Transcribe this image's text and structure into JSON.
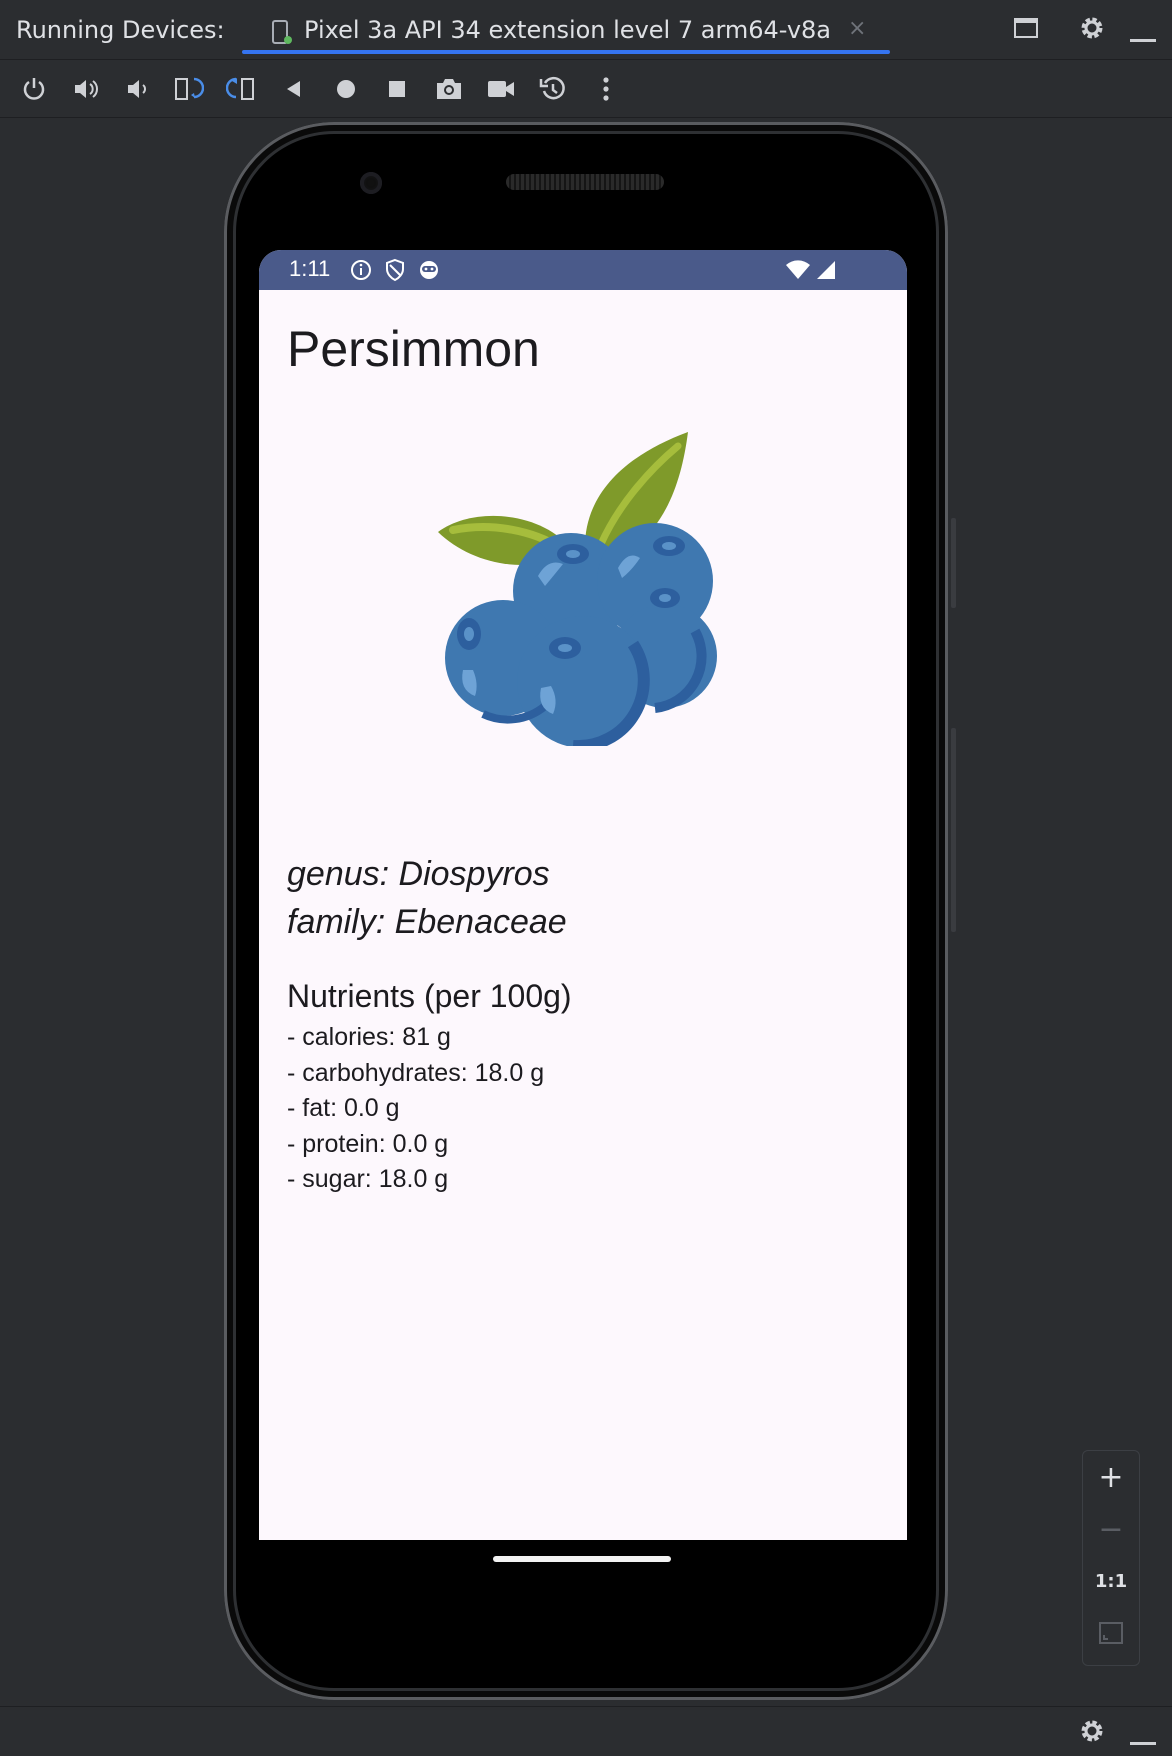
{
  "window": {
    "panel_label": "Running Devices:",
    "device_tab": "Pixel 3a API 34 extension level 7 arm64-v8a",
    "close_glyph": "×"
  },
  "toolbar": {
    "icons": [
      "power-icon",
      "volume-up-icon",
      "volume-down-icon",
      "rotate-left-icon",
      "rotate-right-icon",
      "back-icon",
      "home-icon",
      "overview-icon",
      "screenshot-icon",
      "screen-record-icon",
      "snapshot-icon",
      "more-icon"
    ]
  },
  "status_bar": {
    "time": "1:11"
  },
  "app": {
    "title": "Persimmon",
    "genus": "genus: Diospyros",
    "family": "family: Ebenaceae",
    "nutrients_heading": "Nutrients (per 100g)",
    "nutrients": [
      "- calories: 81 g",
      "- carbohydrates: 18.0 g",
      "- fat: 0.0 g",
      "- protein: 0.0 g",
      "- sugar: 18.0 g"
    ]
  },
  "zoom": {
    "plus": "+",
    "minus": "−",
    "one_to_one": "1:1"
  },
  "colors": {
    "accent": "#3574f0",
    "status_bar": "#4a5a8a",
    "screen_bg": "#fdf8fd",
    "berry": "#3f78b0",
    "leaf": "#7f9a2a"
  }
}
